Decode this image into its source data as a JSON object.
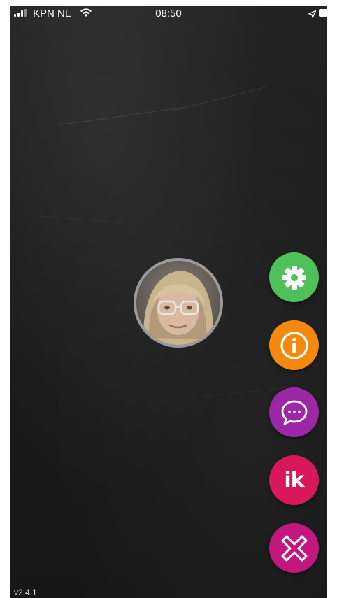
{
  "status_bar": {
    "carrier": "KPN NL",
    "time": "08:50",
    "icons": [
      "signal-icon",
      "wifi-icon",
      "location-arrow-icon",
      "battery-icon"
    ]
  },
  "avatar": {
    "icon": "profile-photo"
  },
  "menu": {
    "buttons": [
      {
        "name": "settings",
        "icon": "gear-icon",
        "color": "#4fc15a"
      },
      {
        "name": "info",
        "icon": "info-icon",
        "color": "#f5890e"
      },
      {
        "name": "chat",
        "icon": "chat-bubble-icon",
        "color": "#9c27a7"
      },
      {
        "name": "ik",
        "label": "ik",
        "color": "#d7195c"
      },
      {
        "name": "close",
        "icon": "close-x-icon",
        "color": "#c2177f"
      }
    ]
  },
  "footer": {
    "version": "v2.4.1"
  }
}
